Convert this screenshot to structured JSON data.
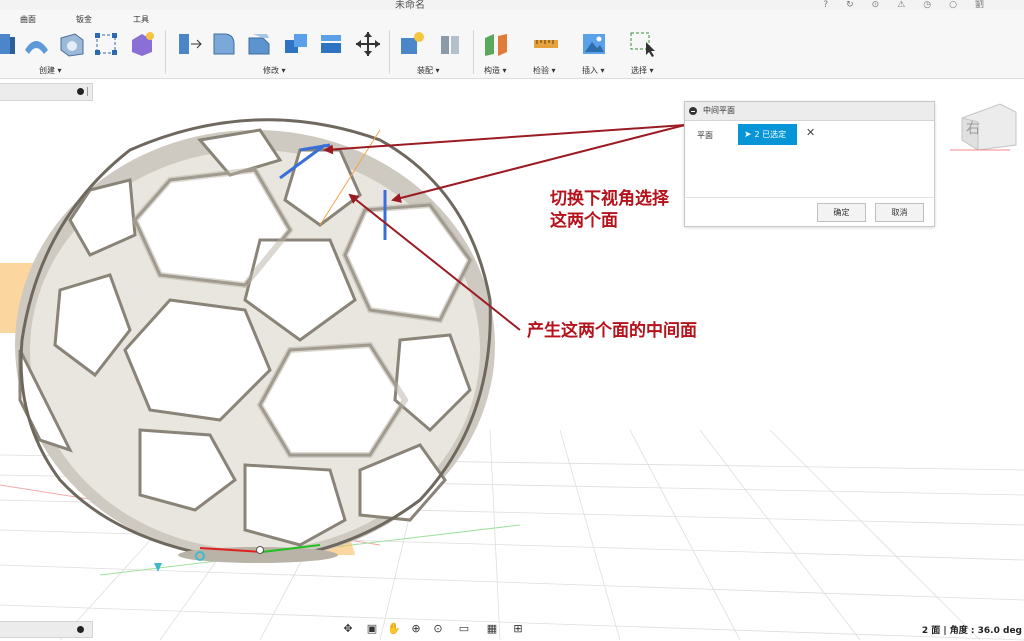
{
  "window": {
    "title": "未命名",
    "controls": [
      "?",
      "↻",
      "⊙",
      "⚠",
      "◷",
      "○",
      "劉"
    ]
  },
  "toolbar": {
    "tabs": [
      "曲面",
      "钣金",
      "工具"
    ],
    "groups": {
      "create": "创建 ▾",
      "modify": "修改 ▾",
      "assemble": "装配 ▾",
      "construct": "构造 ▾",
      "inspect": "检验 ▾",
      "insert": "插入 ▾",
      "select": "选择 ▾"
    },
    "icons": {
      "extrude": "extrude-icon",
      "patch": "patch-icon",
      "shell": "shell-icon",
      "sketch-points": "sketch-points-icon",
      "form": "form-icon",
      "press-pull": "press-pull-icon",
      "fillet": "fillet-icon",
      "chamfer": "chamfer-icon",
      "combine": "combine-icon",
      "offset-face": "offset-face-icon",
      "move": "move-icon",
      "new-component": "new-component-icon",
      "joint": "joint-icon",
      "midplane": "midplane-icon",
      "measure": "measure-icon",
      "insert-image": "insert-image-icon",
      "select": "select-icon"
    }
  },
  "dialog": {
    "title": "中间平面",
    "row_label": "平面",
    "selection": "2 已选定",
    "clear": "✕",
    "ok": "确定",
    "cancel": "取消"
  },
  "annotations": {
    "note1_line1": "切换下视角选择",
    "note1_line2": "这两个面",
    "note2": "产生这两个面的中间面"
  },
  "viewcube": {
    "face_label": "右"
  },
  "status": {
    "text": "2 面 | 角度 : 36.0 deg"
  },
  "colors": {
    "accent": "#0696d7",
    "annotation": "#b5121b",
    "arrow": "#9b1b23"
  }
}
